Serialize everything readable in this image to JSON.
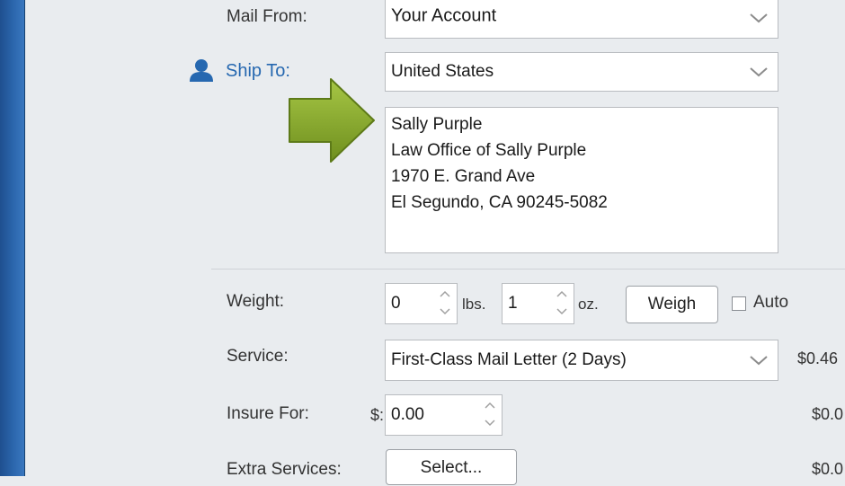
{
  "mail_from": {
    "label": "Mail From:",
    "value": "Your Account"
  },
  "ship_to": {
    "label": "Ship To:",
    "country": "United States",
    "address_lines": [
      "Sally Purple",
      "Law Office of Sally Purple",
      "1970 E. Grand Ave",
      "El Segundo, CA 90245-5082"
    ]
  },
  "weight": {
    "label": "Weight:",
    "lbs_value": "0",
    "lbs_unit": "lbs.",
    "oz_value": "1",
    "oz_unit": "oz.",
    "weigh_button": "Weigh",
    "auto_label": "Auto",
    "auto_checked": false
  },
  "service": {
    "label": "Service:",
    "value": "First-Class Mail Letter (2 Days)",
    "price": "$0.46"
  },
  "insure": {
    "label": "Insure For:",
    "currency": "$:",
    "value": "0.00",
    "price": "$0.0"
  },
  "extra_services": {
    "label": "Extra Services:",
    "button": "Select...",
    "price": "$0.0"
  },
  "icons": {
    "person": "person-icon",
    "arrow": "arrow-right-icon"
  },
  "colors": {
    "accent": "#2668b0",
    "arrow": "#8cb02d",
    "sidebar": "#2b66ad"
  }
}
